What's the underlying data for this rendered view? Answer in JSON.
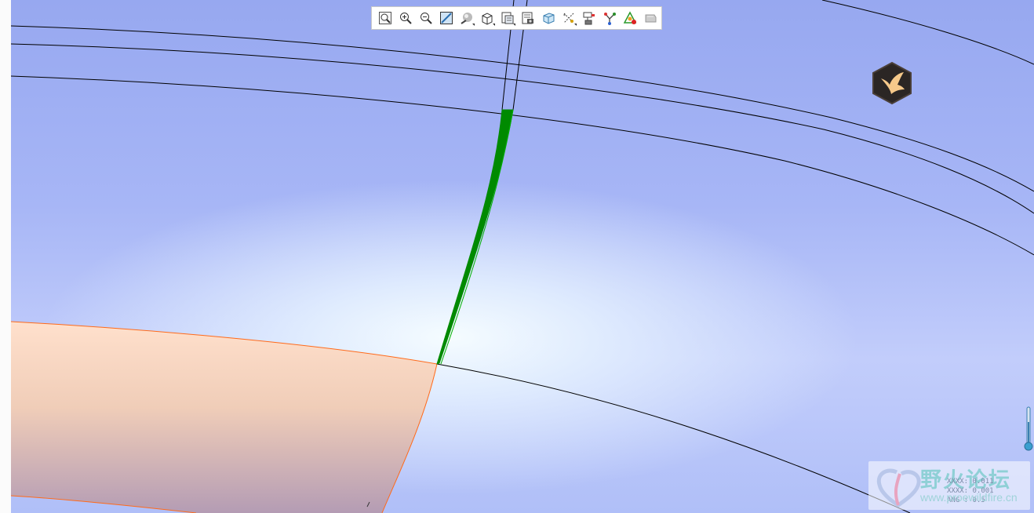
{
  "toolbar": {
    "buttons": [
      {
        "name": "refit-button",
        "icon": "magnifier-box-icon",
        "flyout": false
      },
      {
        "name": "zoom-in-button",
        "icon": "zoom-in-icon",
        "flyout": false
      },
      {
        "name": "zoom-out-button",
        "icon": "zoom-out-icon",
        "flyout": false
      },
      {
        "name": "repaint-button",
        "icon": "repaint-icon",
        "flyout": false
      },
      {
        "name": "shading-button",
        "icon": "shading-sphere-icon",
        "flyout": true
      },
      {
        "name": "view-orientation-button",
        "icon": "cube-view-icon",
        "flyout": true
      },
      {
        "name": "saved-views-button",
        "icon": "saved-views-icon",
        "flyout": true
      },
      {
        "name": "view-manager-button",
        "icon": "view-manager-icon",
        "flyout": false
      },
      {
        "name": "perspective-button",
        "icon": "perspective-cube-icon",
        "flyout": false
      },
      {
        "name": "datum-display-button",
        "icon": "datum-display-icon",
        "flyout": true
      },
      {
        "name": "annotation-display-button",
        "icon": "annotation-display-icon",
        "flyout": false
      },
      {
        "name": "spin-center-button",
        "icon": "spin-center-icon",
        "flyout": false
      },
      {
        "name": "appearance-button",
        "icon": "appearance-triangle-icon",
        "flyout": false
      },
      {
        "name": "section-button",
        "icon": "section-plane-icon",
        "flyout": false
      }
    ]
  },
  "watermark": {
    "title": "野火论坛",
    "url": "www.proewildfire.cn",
    "readout": [
      "XXXX: 0.011",
      "XXXX: 0.001",
      "ANG : 0.5"
    ]
  },
  "colors": {
    "background_top": "#97a8f0",
    "background_glow": "#f5fcff",
    "selection_green": "#008a00",
    "surface_orange": "#ff6a1a",
    "surface_fill": "#f7d4bf",
    "badge_bg": "#2b2624",
    "badge_bird": "#f6c98a"
  }
}
